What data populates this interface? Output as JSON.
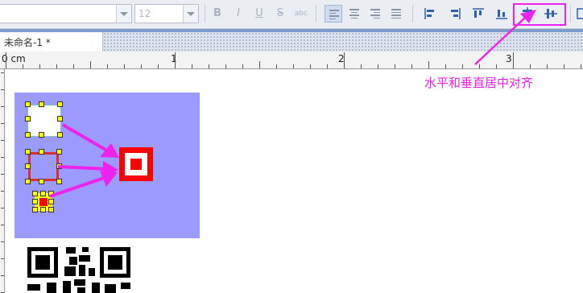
{
  "toolbar": {
    "font_family_value": "",
    "font_size_value": "12",
    "format_buttons": [
      "B",
      "I",
      "U",
      "S",
      "abc"
    ],
    "align_buttons": [
      "align-left",
      "align-center",
      "align-right",
      "justify"
    ],
    "object_align_buttons": [
      "align-left-edges",
      "align-right-edges",
      "align-top-edges",
      "align-bottom-edges",
      "center-horizontally",
      "center-vertically"
    ],
    "highlight_color": "#ee22ee"
  },
  "tabs": [
    {
      "label": "未命名-1 *"
    }
  ],
  "ruler": {
    "zero_label": "0 cm",
    "marks": [
      "1",
      "2",
      "3"
    ]
  },
  "annotation": {
    "text": "水平和垂直居中对齐",
    "color": "#ee22ee"
  },
  "canvas": {
    "background_shape_color": "#9b9bff",
    "target_color": "#ff0000"
  }
}
